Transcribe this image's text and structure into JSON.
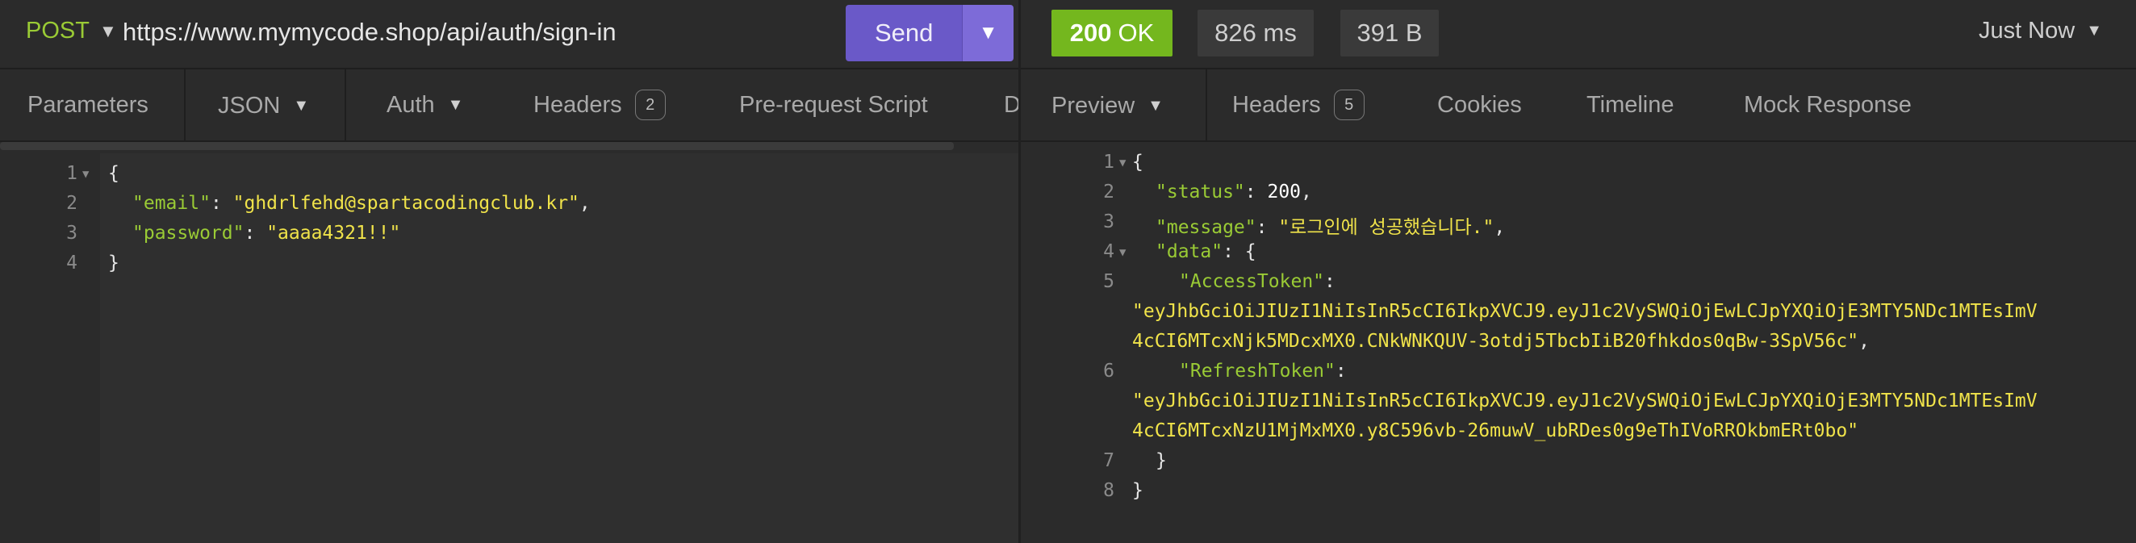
{
  "request": {
    "method": "POST",
    "url": "https://www.mymycode.shop/api/auth/sign-in",
    "send_label": "Send",
    "tabs": [
      {
        "label": "Parameters"
      },
      {
        "label": "JSON"
      },
      {
        "label": "Auth"
      },
      {
        "label": "Headers",
        "badge": "2"
      },
      {
        "label": "Pre-request Script"
      },
      {
        "label": "D"
      }
    ],
    "body_lines": [
      "1",
      "2",
      "3",
      "4"
    ],
    "body": {
      "l1": "{",
      "email_key": "\"email\"",
      "email_val": "\"ghdrlfehd@spartacodingclub.kr\"",
      "password_key": "\"password\"",
      "password_val": "\"aaaa4321!!\"",
      "l4": "}"
    }
  },
  "response": {
    "status_code": "200",
    "status_text": "OK",
    "time": "826 ms",
    "size": "391 B",
    "history": "Just Now",
    "tabs": [
      {
        "label": "Preview"
      },
      {
        "label": "Headers",
        "badge": "5"
      },
      {
        "label": "Cookies"
      },
      {
        "label": "Timeline"
      },
      {
        "label": "Mock Response"
      }
    ],
    "line_numbers": [
      "1",
      "2",
      "3",
      "4",
      "5",
      "6",
      "7",
      "8"
    ],
    "body": {
      "l1": "{",
      "status_key": "\"status\"",
      "status_val": "200",
      "message_key": "\"message\"",
      "message_val": "\"로그인에 성공했습니다.\"",
      "data_key": "\"data\"",
      "access_key": "\"AccessToken\"",
      "access_val_1": "\"eyJhbGciOiJIUzI1NiIsInR5cCI6IkpXVCJ9.eyJ1c2VySWQiOjEwLCJpYXQiOjE3MTY5NDc1MTEsImV",
      "access_val_2": "4cCI6MTcxNjk5MDcxMX0.CNkWNKQUV-3otdj5TbcbIiB20fhkdos0qBw-3SpV56c\"",
      "refresh_key": "\"RefreshToken\"",
      "refresh_val_1": "\"eyJhbGciOiJIUzI1NiIsInR5cCI6IkpXVCJ9.eyJ1c2VySWQiOjEwLCJpYXQiOjE3MTY5NDc1MTEsImV",
      "refresh_val_2": "4cCI6MTcxNzU1MjMxMX0.y8C596vb-26muwV_ubRDes0g9eThIVoRROkbmERt0bo\"",
      "l7": "}",
      "l8": "}"
    }
  },
  "colors": {
    "accent": "#6a59c8",
    "status_ok": "#74b71e",
    "key": "#9acb35",
    "string": "#f0e34a"
  }
}
